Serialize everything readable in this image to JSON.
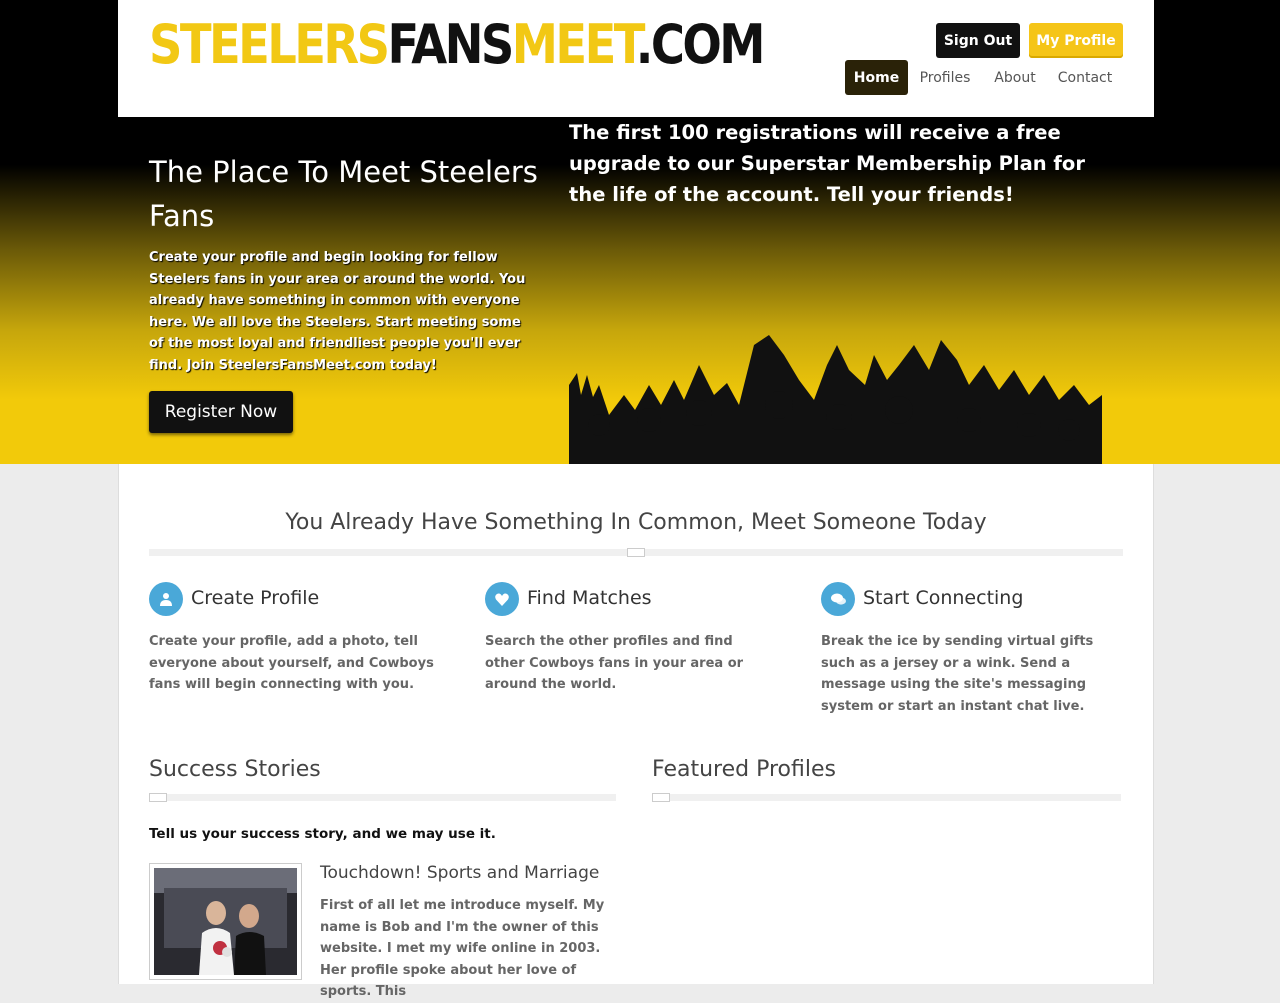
{
  "header": {
    "logo": {
      "part1": "STEELERS",
      "part2": "FANS",
      "part3": "MEET",
      "part4": ".COM"
    },
    "sign_out": "Sign Out",
    "my_profile": "My Profile",
    "nav": [
      "Home",
      "Profiles",
      "About",
      "Contact"
    ]
  },
  "hero": {
    "title": "The Place To Meet Steelers Fans",
    "text": "Create your profile and begin looking for fellow Steelers fans in your area or around the world. You already have something in common with everyone here. We all love the Steelers. Start meeting some of the most loyal and friendliest people you'll ever find. Join SteelersFansMeet.com today!",
    "register": "Register Now",
    "announcement": "The first 100 registrations will receive a free upgrade to our Superstar Membership Plan for the life of the account. Tell your friends!"
  },
  "section": {
    "heading": "You Already Have Something In Common, Meet Someone Today"
  },
  "features": [
    {
      "icon": "user-icon",
      "title": "Create Profile",
      "text": "Create your profile, add a photo, tell everyone about yourself, and Cowboys fans will begin connecting with you."
    },
    {
      "icon": "heart-icon",
      "title": "Find Matches",
      "text": "Search the other profiles and find other Cowboys fans in your area or around the world."
    },
    {
      "icon": "chat-icon",
      "title": "Start Connecting",
      "text": "Break the ice by sending virtual gifts such as a jersey or a wink.  Send a message using the site's messaging system or start an instant chat live."
    }
  ],
  "success": {
    "heading": "Success Stories",
    "tagline": "Tell us your success story, and we may use it.",
    "story_title": "Touchdown! Sports and Marriage",
    "story_text": "First of all let me introduce myself. My name is Bob and I'm the owner of this website. I met my wife online in 2003. Her profile spoke about her love of sports. This"
  },
  "featured": {
    "heading": "Featured Profiles"
  },
  "colors": {
    "brand_yellow": "#f2c814",
    "black": "#111111",
    "icon_blue": "#4aa8d8"
  }
}
